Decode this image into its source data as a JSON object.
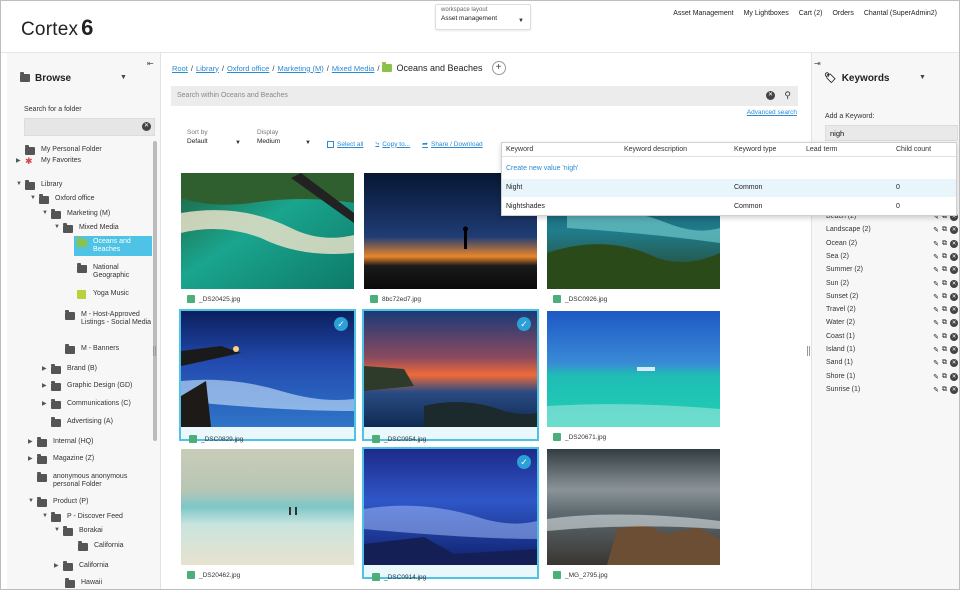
{
  "app": {
    "name": "Cortex",
    "version": "6"
  },
  "workspace": {
    "label": "workspace layout",
    "value": "Asset management"
  },
  "top_nav": [
    "Asset Management",
    "My Lightboxes",
    "Cart (2)",
    "Orders",
    "Chantal (SuperAdmin2)"
  ],
  "browse": {
    "title": "Browse",
    "search_label": "Search for a folder",
    "tree": [
      {
        "label": "My Personal Folder",
        "icon": "folder"
      },
      {
        "label": "My Favorites",
        "icon": "star"
      },
      {
        "label": "Library",
        "icon": "folder"
      },
      {
        "label": "Oxford office",
        "icon": "folder"
      },
      {
        "label": "Marketing (M)",
        "icon": "folder"
      },
      {
        "label": "Mixed Media",
        "icon": "folder"
      },
      {
        "label": "Oceans and Beaches",
        "icon": "green-folder",
        "selected": true
      },
      {
        "label": "National Geographic",
        "icon": "folder"
      },
      {
        "label": "Yoga Music",
        "icon": "green-square"
      },
      {
        "label": "M - Host-Approved Listings - Social Media",
        "icon": "folder"
      },
      {
        "label": "M - Banners",
        "icon": "folder"
      },
      {
        "label": "Brand (B)",
        "icon": "folder"
      },
      {
        "label": "Graphic Design (GD)",
        "icon": "folder"
      },
      {
        "label": "Communications (C)",
        "icon": "folder"
      },
      {
        "label": "Advertising (A)",
        "icon": "folder"
      },
      {
        "label": "Internal (HQ)",
        "icon": "folder"
      },
      {
        "label": "Magazine (Z)",
        "icon": "folder"
      },
      {
        "label": "anonymous anonymous personal Folder",
        "icon": "folder"
      },
      {
        "label": "Product (P)",
        "icon": "folder"
      },
      {
        "label": "P - Discover Feed",
        "icon": "folder"
      },
      {
        "label": "Borakai",
        "icon": "folder"
      },
      {
        "label": "California",
        "icon": "folder"
      },
      {
        "label": "California",
        "icon": "folder"
      },
      {
        "label": "Hawaii",
        "icon": "folder"
      }
    ]
  },
  "breadcrumb": {
    "items": [
      "Root",
      "Library",
      "Oxford office",
      "Marketing (M)",
      "Mixed Media"
    ],
    "current": "Oceans and Beaches"
  },
  "search": {
    "placeholder": "Search within Oceans and Beaches",
    "advanced": "Advanced search"
  },
  "toolbar": {
    "sort_label": "Sort by",
    "sort_value": "Default",
    "display_label": "Display",
    "display_value": "Medium",
    "select_all": "Select all",
    "copy_to": "Copy to...",
    "share": "Share / Download"
  },
  "assets": [
    {
      "name": "_DS20425.jpg",
      "selected": false
    },
    {
      "name": "8bc72ed7.jpg",
      "selected": false
    },
    {
      "name": "_DSC0926.jpg",
      "selected": false
    },
    {
      "name": "_DSC0829.jpg",
      "selected": true
    },
    {
      "name": "_DSC0954.jpg",
      "selected": true
    },
    {
      "name": "_DS20671.jpg",
      "selected": false
    },
    {
      "name": "_DS20462.jpg",
      "selected": false
    },
    {
      "name": "_DSC0914.jpg",
      "selected": true
    },
    {
      "name": "_MG_2795.jpg",
      "selected": false
    }
  ],
  "keyword_dropdown": {
    "headers": [
      "Keyword",
      "Keyword description",
      "Keyword type",
      "Lead term",
      "Child count"
    ],
    "create": "Create new value 'nigh'",
    "rows": [
      {
        "keyword": "Night",
        "description": "",
        "type": "Common",
        "lead": "",
        "count": "0"
      },
      {
        "keyword": "Nightshades",
        "description": "",
        "type": "Common",
        "lead": "",
        "count": "0"
      }
    ]
  },
  "keywords": {
    "title": "Keywords",
    "add_label": "Add a Keyword:",
    "input_value": "nigh",
    "list": [
      "Beach (2)",
      "Landscape (2)",
      "Ocean (2)",
      "Sea (2)",
      "Summer (2)",
      "Sun (2)",
      "Sunset (2)",
      "Travel (2)",
      "Water (2)",
      "Coast (1)",
      "Island (1)",
      "Sand (1)",
      "Shore (1)",
      "Sunrise (1)"
    ]
  },
  "colors": {
    "accent": "#4ec3e5",
    "link": "#2a8ad4",
    "check": "#2a9fd8"
  }
}
